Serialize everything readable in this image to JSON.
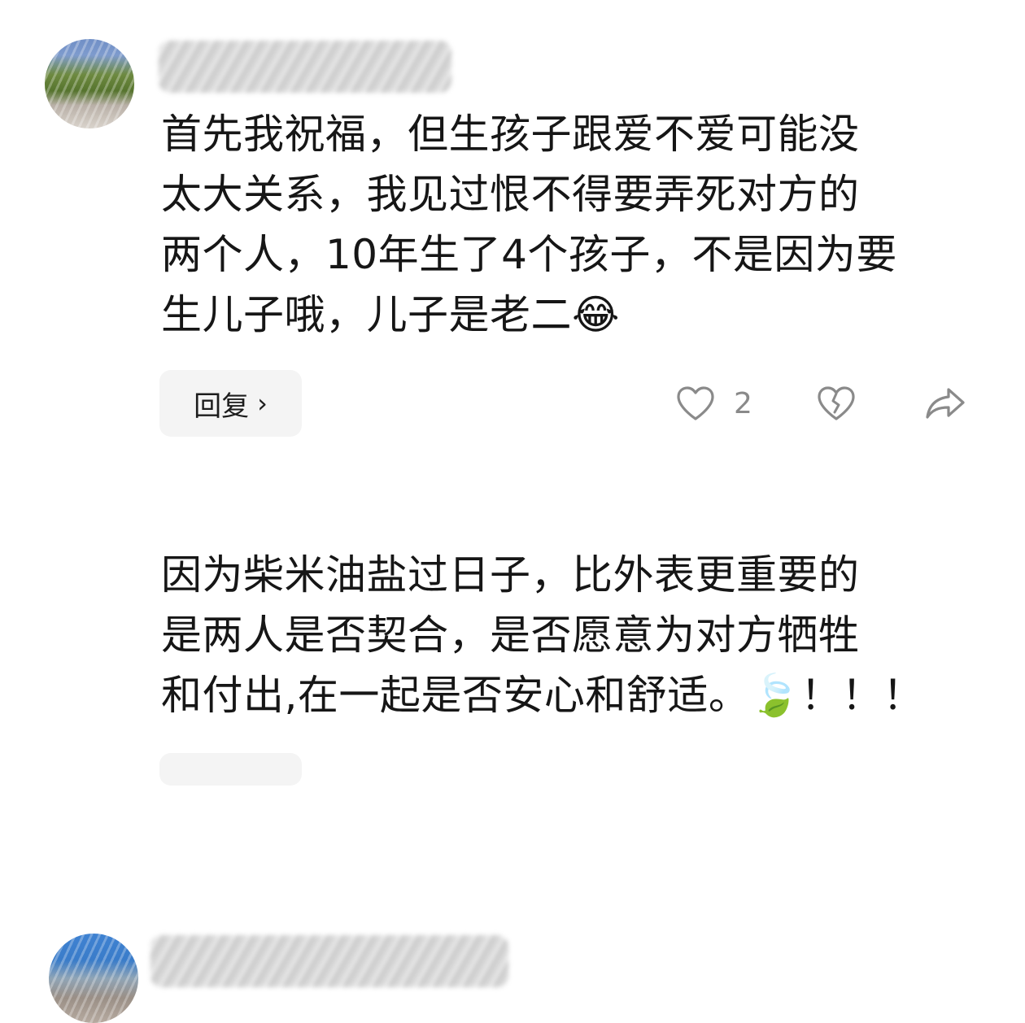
{
  "comments": [
    {
      "text": "首先我祝福，但生孩子跟爱不爱可能没\n太大关系，我见过恨不得要弄死对方的\n两个人，10年生了4个孩子，不是因为要\n生儿子哦，儿子是老二😂",
      "reply_label": "回复",
      "like_count": "2"
    },
    {
      "text": "因为柴米油盐过日子，比外表更重要的\n是两人是否契合，是否愿意为对方牺牲\n和付出,在一起是否安心和舒适。🍃！！！"
    }
  ],
  "icons": {
    "reply_chevron": "chevron-right-icon",
    "like": "heart-outline-icon",
    "dislike": "broken-heart-icon",
    "share": "share-arrow-icon"
  },
  "colors": {
    "icon_gray": "#8a8a8a",
    "reply_bg": "#f4f4f4"
  }
}
